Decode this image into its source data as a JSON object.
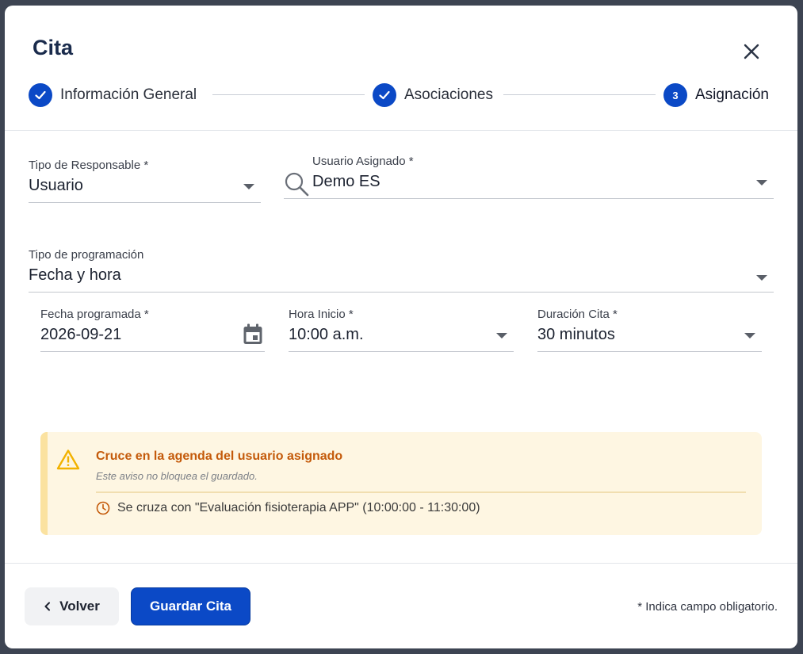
{
  "dialog": {
    "title": "Cita",
    "close_icon": "close-icon"
  },
  "stepper": {
    "steps": [
      {
        "label": "Información General",
        "state": "completed",
        "icon": "check-icon"
      },
      {
        "label": "Asociaciones",
        "state": "completed",
        "icon": "check-icon"
      },
      {
        "label": "Asignación",
        "state": "active",
        "number": "3"
      }
    ],
    "accent_color": "#0b49c6"
  },
  "form": {
    "responsible_type": {
      "label": "Tipo de Responsable *",
      "value": "Usuario"
    },
    "assigned_user": {
      "label": "Usuario Asignado *",
      "value": "Demo ES",
      "icon": "search-icon"
    },
    "schedule_type": {
      "label": "Tipo de programación",
      "value": "Fecha y hora"
    },
    "scheduled_date": {
      "label": "Fecha programada *",
      "value": "2026-09-21",
      "icon": "calendar-icon"
    },
    "start_time": {
      "label": "Hora Inicio *",
      "value": "10:00 a.m."
    },
    "duration": {
      "label": "Duración Cita *",
      "value": "30 minutos"
    }
  },
  "alert": {
    "icon": "warning-icon",
    "title": "Cruce en la agenda del usuario asignado",
    "subtitle": "Este aviso no bloquea el guardado.",
    "detail_icon": "clock-icon",
    "detail": "Se cruza con \"Evaluación fisioterapia APP\" (10:00:00 - 11:30:00)",
    "title_color": "#c45a0a",
    "background_color": "#fef6e2"
  },
  "footer": {
    "back_label": "Volver",
    "back_icon": "chevron-left-icon",
    "save_label": "Guardar Cita",
    "required_note": "* Indica campo obligatorio."
  }
}
